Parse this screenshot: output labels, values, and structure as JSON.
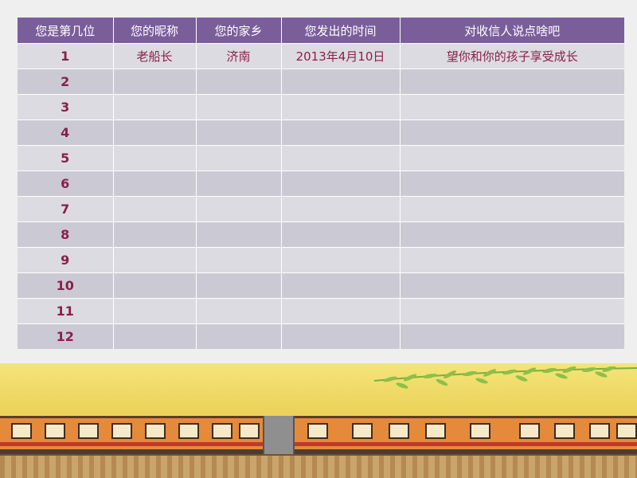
{
  "table": {
    "headers": [
      "您是第几位",
      "您的昵称",
      "您的家乡",
      "您发出的时间",
      "对收信人说点啥吧"
    ],
    "rows": [
      [
        "1",
        "老船长",
        "济南",
        "2013年4月10日",
        "望你和你的孩子享受成长"
      ],
      [
        "2",
        "",
        "",
        "",
        ""
      ],
      [
        "3",
        "",
        "",
        "",
        ""
      ],
      [
        "4",
        "",
        "",
        "",
        ""
      ],
      [
        "5",
        "",
        "",
        "",
        ""
      ],
      [
        "6",
        "",
        "",
        "",
        ""
      ],
      [
        "7",
        "",
        "",
        "",
        ""
      ],
      [
        "8",
        "",
        "",
        "",
        ""
      ],
      [
        "9",
        "",
        "",
        "",
        ""
      ],
      [
        "10",
        "",
        "",
        "",
        ""
      ],
      [
        "11",
        "",
        "",
        "",
        ""
      ],
      [
        "12",
        "",
        "",
        "",
        ""
      ]
    ]
  },
  "colors": {
    "header_bg": "#7a5e9a",
    "row_light": "#dcdbe2",
    "row_dark": "#cbc9d4",
    "text_accent": "#8a1f4a",
    "illustration_sky": "#ecd35c",
    "train_body": "#e48a3a"
  },
  "illustration": {
    "icon": "train-illustration-icon"
  }
}
